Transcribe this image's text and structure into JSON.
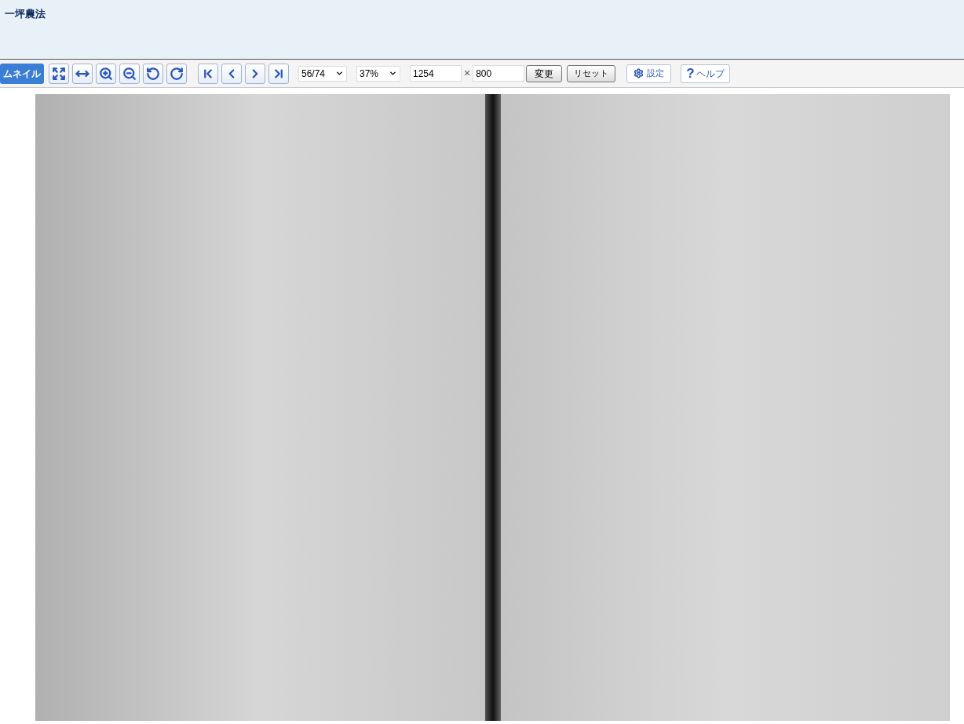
{
  "header": {
    "title": "一坪農法"
  },
  "toolbar": {
    "thumbnail_tab": {
      "label": "ムネイル",
      "selected": true
    },
    "page_select": {
      "value": "56/74"
    },
    "zoom_select": {
      "value": "37%"
    },
    "width_field": {
      "value": "1254"
    },
    "times_sign": "×",
    "height_field": {
      "value": "800"
    },
    "apply_button": "変更",
    "reset_button": "リセット",
    "settings_button": "設定",
    "help_button": {
      "icon_char": "?",
      "label": "ヘルプ"
    }
  }
}
